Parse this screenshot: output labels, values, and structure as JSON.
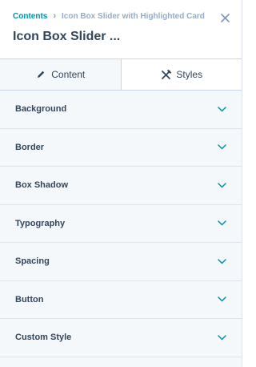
{
  "breadcrumb": {
    "root": "Contents",
    "separator": "›",
    "current": "Icon Box Slider with Highlighted Card"
  },
  "title": "Icon Box Slider ...",
  "icons": {
    "close": "close-icon",
    "content_tab": "pencil-icon",
    "styles_tab": "styles-tools-icon",
    "section_expand": "chevron-down-icon"
  },
  "tabs": [
    {
      "label": "Content",
      "active": false
    },
    {
      "label": "Styles",
      "active": true
    }
  ],
  "sections": [
    {
      "label": "Background"
    },
    {
      "label": "Border"
    },
    {
      "label": "Box Shadow"
    },
    {
      "label": "Typography"
    },
    {
      "label": "Spacing"
    },
    {
      "label": "Button"
    },
    {
      "label": "Custom Style"
    }
  ],
  "colors": {
    "link": "#0091ae",
    "text": "#33475b",
    "muted": "#99acc2",
    "section_bg": "#f5f8fa",
    "divider": "#dfe3eb"
  }
}
